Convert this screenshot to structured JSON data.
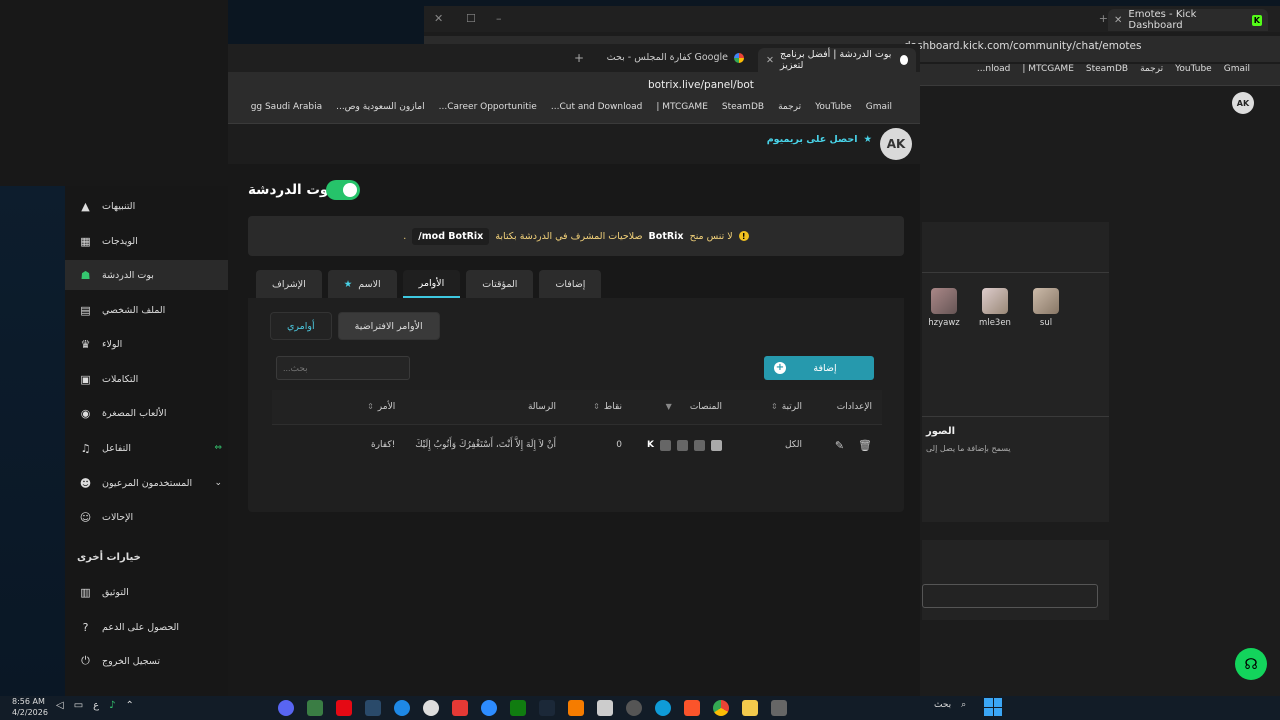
{
  "bg_window": {
    "tab_title": "Emotes - Kick Dashboard",
    "url": "dashboard.kick.com/community/chat/emotes",
    "bookmarks": [
      "Gmail",
      "YouTube",
      "ترجمة",
      "SteamDB",
      "MTCGAME |",
      "nload..."
    ],
    "users": [
      "hzyawz",
      "mle3en",
      "sul"
    ],
    "section_title": "الصور",
    "section_subtitle": "يسمح بإضافة ما يصل إلى",
    "avatar_initials": "AK"
  },
  "window": {
    "active_tab": "بوت الدردشة | أفضل برنامج لتعزيز",
    "second_tab": "كفارة المجلس - بحث Google",
    "url": "botrix.live/panel/bot",
    "bookmarks": [
      "Gmail",
      "YouTube",
      "ترجمة",
      "SteamDB",
      "MTCGAME |",
      "Cut and Download...",
      "Career Opportunitie...",
      "أمازون السعودية وص...",
      "gg Saudi Arabia"
    ]
  },
  "header": {
    "premium_label": "احصل على بريميوم",
    "avatar_initials": "AK"
  },
  "page": {
    "title": "بوت الدردشة",
    "alert": {
      "prefix": "لا تنس منح",
      "bot": "BotRix",
      "middle": "صلاحيات المشرف في الدردشة بكتابة",
      "command": "/mod BotRix",
      "suffix": "."
    },
    "tabs": [
      "إضافات",
      "المؤقتات",
      "الأوامر",
      "الاسم",
      "الإشراف"
    ],
    "active_tab": "الأوامر",
    "subtabs": [
      "الأوامر الافتراضية",
      "أوامري"
    ],
    "search_placeholder": "بحث...",
    "add_label": "إضافة",
    "columns": {
      "command": "الأمر",
      "message": "الرسالة",
      "points": "نقاط",
      "platforms": "المنصات",
      "rank": "الرتبة",
      "settings": "الإعدادات"
    },
    "rows": [
      {
        "command": "!كفارة",
        "message": "أَنْ لاَ إِلَهَ إِلاَّ أَنْتَ، أَسْتَغْفِرُكَ وَأَتُوبُ إِلَيْكَ",
        "points": "0",
        "rank": "الكل"
      }
    ]
  },
  "sidebar": {
    "items": [
      {
        "label": "التنبيهات",
        "icon": "alert-icon"
      },
      {
        "label": "الويدجات",
        "icon": "widgets-icon"
      },
      {
        "label": "بوت الدردشة",
        "icon": "bot-icon"
      },
      {
        "label": "الملف الشخصي",
        "icon": "profile-icon"
      },
      {
        "label": "الولاء",
        "icon": "trophy-icon"
      },
      {
        "label": "التكاملات",
        "icon": "integrations-icon"
      },
      {
        "label": "الألعاب المصغرة",
        "icon": "gamepad-icon"
      },
      {
        "label": "التفاعل",
        "icon": "music-icon"
      },
      {
        "label": "المستخدمون المرعيون",
        "icon": "users-icon"
      },
      {
        "label": "الإحالات",
        "icon": "referrals-icon"
      }
    ],
    "other_header": "خيارات أخرى",
    "other_items": [
      {
        "label": "التوثيق",
        "icon": "docs-icon"
      },
      {
        "label": "الحصول على الدعم",
        "icon": "help-icon"
      },
      {
        "label": "تسجيل الخروج",
        "icon": "logout-icon"
      }
    ]
  },
  "taskbar": {
    "time": "8:56 AM",
    "date": "4/2/2026",
    "search_label": "بحث",
    "lang": "ع"
  }
}
